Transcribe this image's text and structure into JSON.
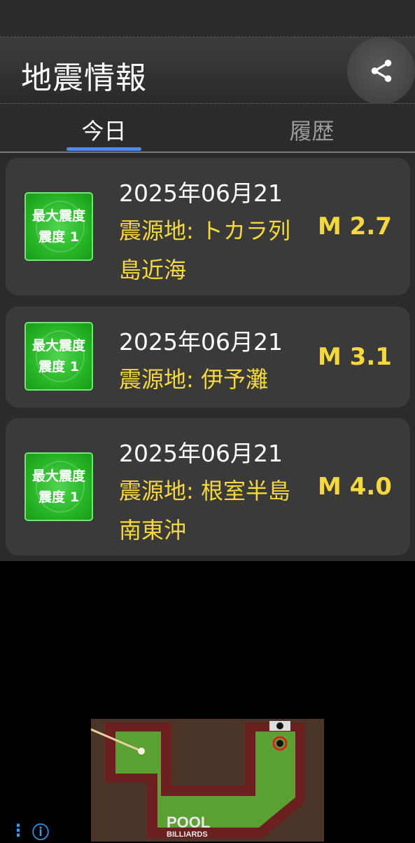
{
  "app": {
    "title": "地震情報"
  },
  "share": {
    "icon": "share-icon"
  },
  "tabs": [
    {
      "label": "今日",
      "active": true
    },
    {
      "label": "履歴",
      "active": false
    }
  ],
  "quakes": [
    {
      "badge_line1": "最大震度",
      "badge_line2": "震度 1",
      "date": "2025年06月21",
      "location": "震源地: トカラ列島近海",
      "magnitude": "M 2.7"
    },
    {
      "badge_line1": "最大震度",
      "badge_line2": "震度 1",
      "date": "2025年06月21",
      "location": "震源地: 伊予灘",
      "magnitude": "M 3.1"
    },
    {
      "badge_line1": "最大震度",
      "badge_line2": "震度 1",
      "date": "2025年06月21",
      "location": "震源地: 根室半島南東沖",
      "magnitude": "M 4.0"
    }
  ],
  "ad": {
    "logo_line1": "POOL",
    "logo_line2": "BILLIARDS"
  },
  "colors": {
    "accent": "#4d8df0",
    "magnitude": "#f5d93c",
    "badge": "#22b022"
  }
}
